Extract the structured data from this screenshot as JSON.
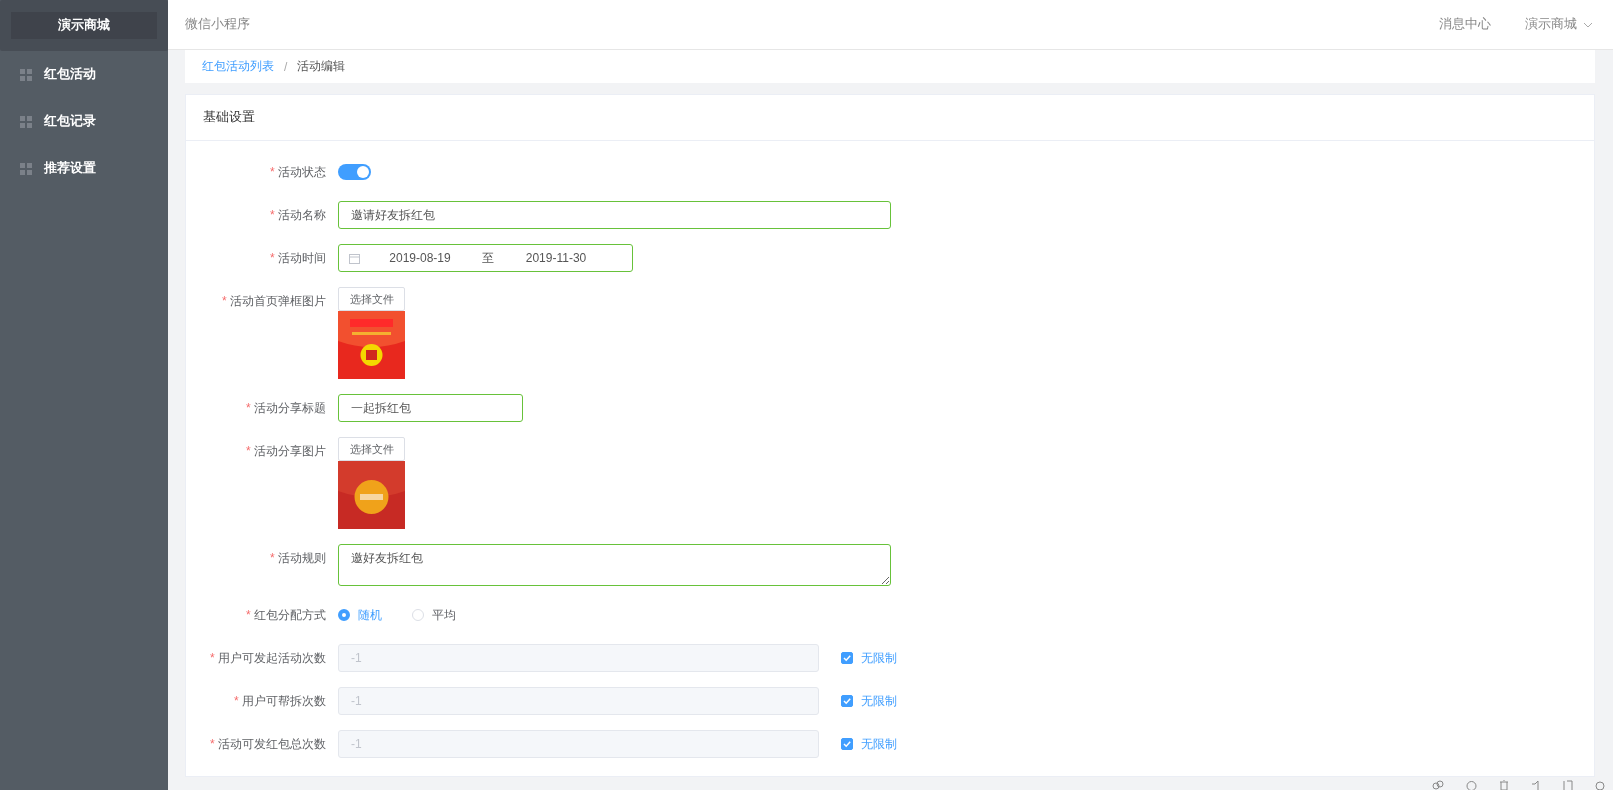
{
  "sidebar": {
    "brand": "演示商城",
    "items": [
      {
        "label": "红包活动",
        "selected": false
      },
      {
        "label": "红包记录",
        "selected": false
      },
      {
        "label": "推荐设置",
        "selected": false
      }
    ]
  },
  "header": {
    "title": "微信小程序",
    "links": [
      "消息中心"
    ],
    "account": "演示商城"
  },
  "breadcrumb": [
    {
      "label": "红包活动列表",
      "link": true
    },
    {
      "label": "活动编辑",
      "link": false
    }
  ],
  "breadcrumb_separator": "/",
  "form": {
    "title": "基础设置",
    "required_mark": "*",
    "items": [
      {
        "kind": "switch",
        "label": "活动状态",
        "required": true,
        "on": true
      },
      {
        "kind": "text",
        "label": "活动名称",
        "required": true,
        "value": "邀请好友拆红包"
      },
      {
        "kind": "daterange",
        "label": "活动时间",
        "required": true,
        "start": "2019-08-19",
        "separator": "至",
        "end": "2019-11-30"
      },
      {
        "kind": "upload",
        "label": "活动首页弹框图片",
        "required": true,
        "button": "选择文件"
      },
      {
        "kind": "text",
        "label": "活动分享标题",
        "required": true,
        "value": "一起拆红包"
      },
      {
        "kind": "upload",
        "label": "活动分享图片",
        "required": true,
        "button": "选择文件"
      },
      {
        "kind": "textarea",
        "label": "活动规则",
        "required": true,
        "value": "邀好友拆红包"
      },
      {
        "kind": "radio",
        "label": "红包分配方式",
        "required": true,
        "options": [
          {
            "label": "随机",
            "selected": true
          },
          {
            "label": "平均",
            "selected": false
          }
        ]
      },
      {
        "kind": "limit",
        "label": "用户可发起活动次数",
        "required": true,
        "value": "-1",
        "disabled": true,
        "checked": true,
        "check_label": "无限制"
      },
      {
        "kind": "limit",
        "label": "用户可帮拆次数",
        "required": true,
        "value": "-1",
        "disabled": true,
        "checked": true,
        "check_label": "无限制"
      },
      {
        "kind": "limit",
        "label": "活动可发红包总次数",
        "required": true,
        "value": "-1",
        "disabled": true,
        "checked": true,
        "check_label": "无限制"
      }
    ]
  }
}
